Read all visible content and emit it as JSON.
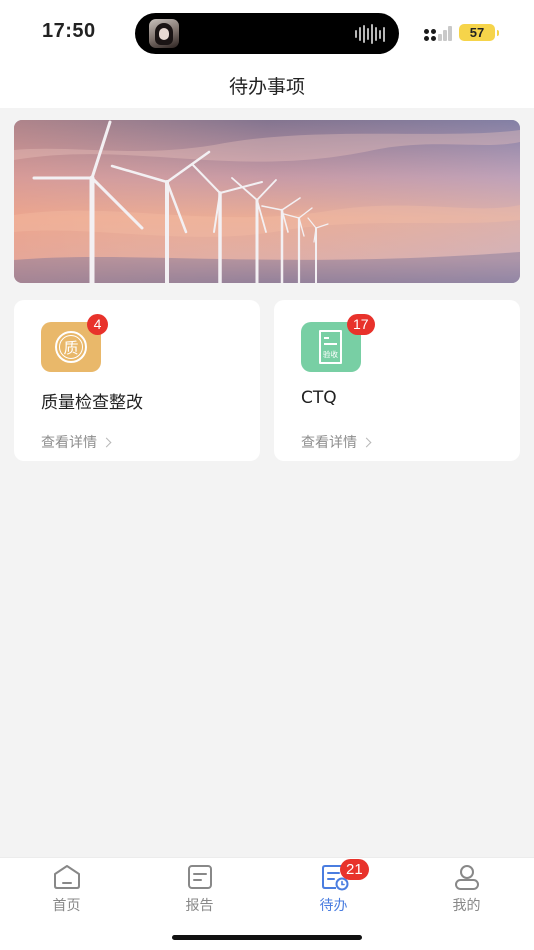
{
  "status_bar": {
    "time": "17:50",
    "battery": "57"
  },
  "nav": {
    "title": "待办事项"
  },
  "cards": [
    {
      "title": "质量检查整改",
      "badge": "4",
      "icon_text": "质",
      "link": "查看详情"
    },
    {
      "title": "CTQ",
      "badge": "17",
      "icon_text": "验收",
      "link": "查看详情"
    }
  ],
  "tabbar": {
    "items": [
      {
        "label": "首页",
        "icon": "home-icon"
      },
      {
        "label": "报告",
        "icon": "report-icon"
      },
      {
        "label": "待办",
        "icon": "todo-icon",
        "badge": "21",
        "active": true
      },
      {
        "label": "我的",
        "icon": "profile-icon"
      }
    ]
  },
  "colors": {
    "accent": "#4a7de0",
    "badge": "#e8322b",
    "quality_icon": "#e9b86a",
    "ctq_icon": "#78cfa4"
  }
}
